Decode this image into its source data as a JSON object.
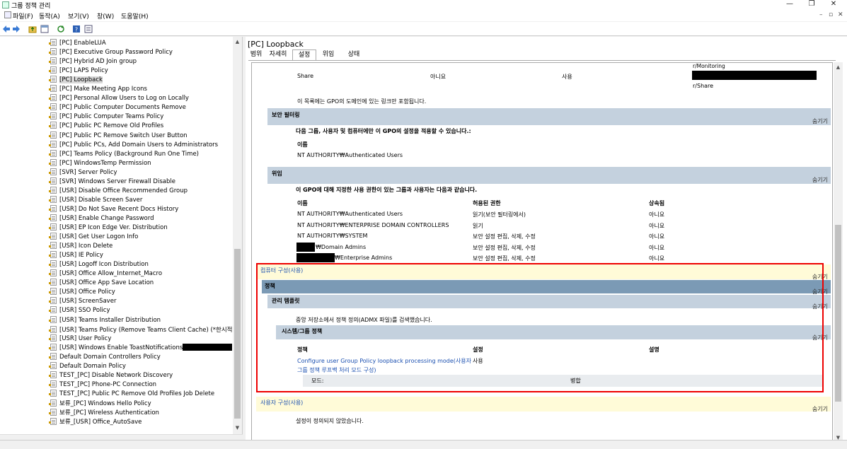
{
  "window": {
    "title": "그룹 정책 관리",
    "controls": {
      "minimize": "—",
      "maximize": "❐",
      "close": "✕"
    }
  },
  "menu": {
    "items": [
      "파일(F)",
      "동작(A)",
      "보기(V)",
      "창(W)",
      "도움말(H)"
    ],
    "mdi_controls": [
      "–",
      "▫",
      "✕"
    ]
  },
  "toolbar": {
    "icons": [
      "back-icon",
      "forward-icon",
      "folder-up-icon",
      "view-icon",
      "refresh-icon",
      "help-icon",
      "properties-icon"
    ]
  },
  "tree": {
    "items": [
      "[PC] EnableLUA",
      "[PC] Executive Group Password Policy",
      "[PC] Hybrid AD Join group",
      "[PC] LAPS Policy",
      "[PC] Loopback",
      "[PC] Make Meeting App Icons",
      "[PC] Personal Allow Users to Log on Locally",
      "[PC] Public Computer Documents Remove",
      "[PC] Public Computer Teams Policy",
      "[PC] Public PC Remove Old Profiles",
      "[PC] Public PC Remove Switch User Button",
      "[PC] Public PCs, Add Domain Users to Administrators",
      "[PC] Teams Policy (Background Run One Time)",
      "[PC] WindowsTemp Permission",
      "[SVR] Server Policy",
      "[SVR] Windows Server Firewall Disable",
      "[USR] Disable Office Recommended Group",
      "[USR] Disable Screen Saver",
      "[USR] Do Not Save Recent Docs History",
      "[USR] Enable Change Password",
      "[USR] EP Icon Edge Ver. Distribution",
      "[USR] Get User Logon Info",
      "[USR] Icon Delete",
      "[USR] IE Policy",
      "[USR] Logoff Icon Distribution",
      "[USR] Office Allow_Internet_Macro",
      "[USR] Office App Save Location",
      "[USR] Office Policy",
      "[USR] ScreenSaver",
      "[USR] SSO Policy",
      "[USR] Teams Installer Distribution",
      "[USR] Teams Policy (Remove Teams Client Cache) (*한시적 사",
      "[USR] User Policy",
      "[USR] Windows Enable ToastNotifications",
      "Default Domain Controllers Policy",
      "Default Domain Policy",
      "TEST_[PC] Disable Network Discovery",
      "TEST_[PC] Phone-PC Connection",
      "TEST_[PC] Public PC Remove Old Profiles Job Delete",
      "보류_[PC] Windows Hello Policy",
      "보류_[PC] Wireless Authentication",
      "보류_[USR] Office_AutoSave"
    ],
    "selected_index": 4
  },
  "pane": {
    "title": "[PC] Loopback",
    "tabs": [
      "범위",
      "자세히",
      "설정",
      "위임",
      "상태"
    ],
    "active_tab": "설정"
  },
  "report": {
    "top_fragment": "r/Monitoring",
    "share_row": {
      "name": "Share",
      "enforced": "아니요",
      "enabled": "사용",
      "path": "r/Share"
    },
    "links_note": "이 목록에는 GPO의 도메인에 있는 링크만 포함됩니다.",
    "hide_label": "숨기기",
    "security": {
      "title": "보안 필터링",
      "desc": "다음 그룹, 사용자 및 컴퓨터에만 이 GPO의 설정을 적용할 수 있습니다.:",
      "name_header": "이름",
      "value": "NT AUTHORITY₩Authenticated Users"
    },
    "delegation": {
      "title": "위임",
      "desc": "이 GPO에 대해 지정한 사용 권한이 있는 그룹과 사용자는 다음과 같습니다.",
      "headers": [
        "이름",
        "허용된 권한",
        "상속됨"
      ],
      "rows": [
        [
          "NT AUTHORITY₩Authenticated Users",
          "읽기(보안 필터링에서)",
          "아니요"
        ],
        [
          "NT AUTHORITY₩ENTERPRISE DOMAIN CONTROLLERS",
          "읽기",
          "아니요"
        ],
        [
          "NT AUTHORITY₩SYSTEM",
          "보안 설정 편집, 삭제, 수정",
          "아니요"
        ],
        [
          "₩Domain Admins",
          "보안 설정 편집, 삭제, 수정",
          "아니요"
        ],
        [
          "₩Enterprise Admins",
          "보안 설정 편집, 삭제, 수정",
          "아니요"
        ]
      ]
    },
    "computer_config": {
      "title": "컴퓨터 구성(사용)",
      "policies": "정책",
      "admin_templates": "관리 템플릿",
      "admx_note": "중앙 저장소에서 정책 정의(ADMX 파일)를 검색했습니다.",
      "system_group": "시스템/그룹 정책",
      "headers": [
        "정책",
        "설정",
        "설명"
      ],
      "policy_line1": "Configure user Group Policy loopback processing mode(사용자",
      "policy_line2": "그룹 정책 루프백 처리 모드 구성)",
      "policy_value": "사용",
      "mode_label": "모드:",
      "mode_value": "병합"
    },
    "user_config": {
      "title": "사용자 구성(사용)",
      "note": "설정이 정의되지 않았습니다."
    }
  },
  "colors": {
    "band_light": "#c4d1de",
    "band_dark": "#7b9ab5",
    "band_yellow": "#fffbd8",
    "highlight_border": "#e00000",
    "link": "#1a4fb0"
  }
}
